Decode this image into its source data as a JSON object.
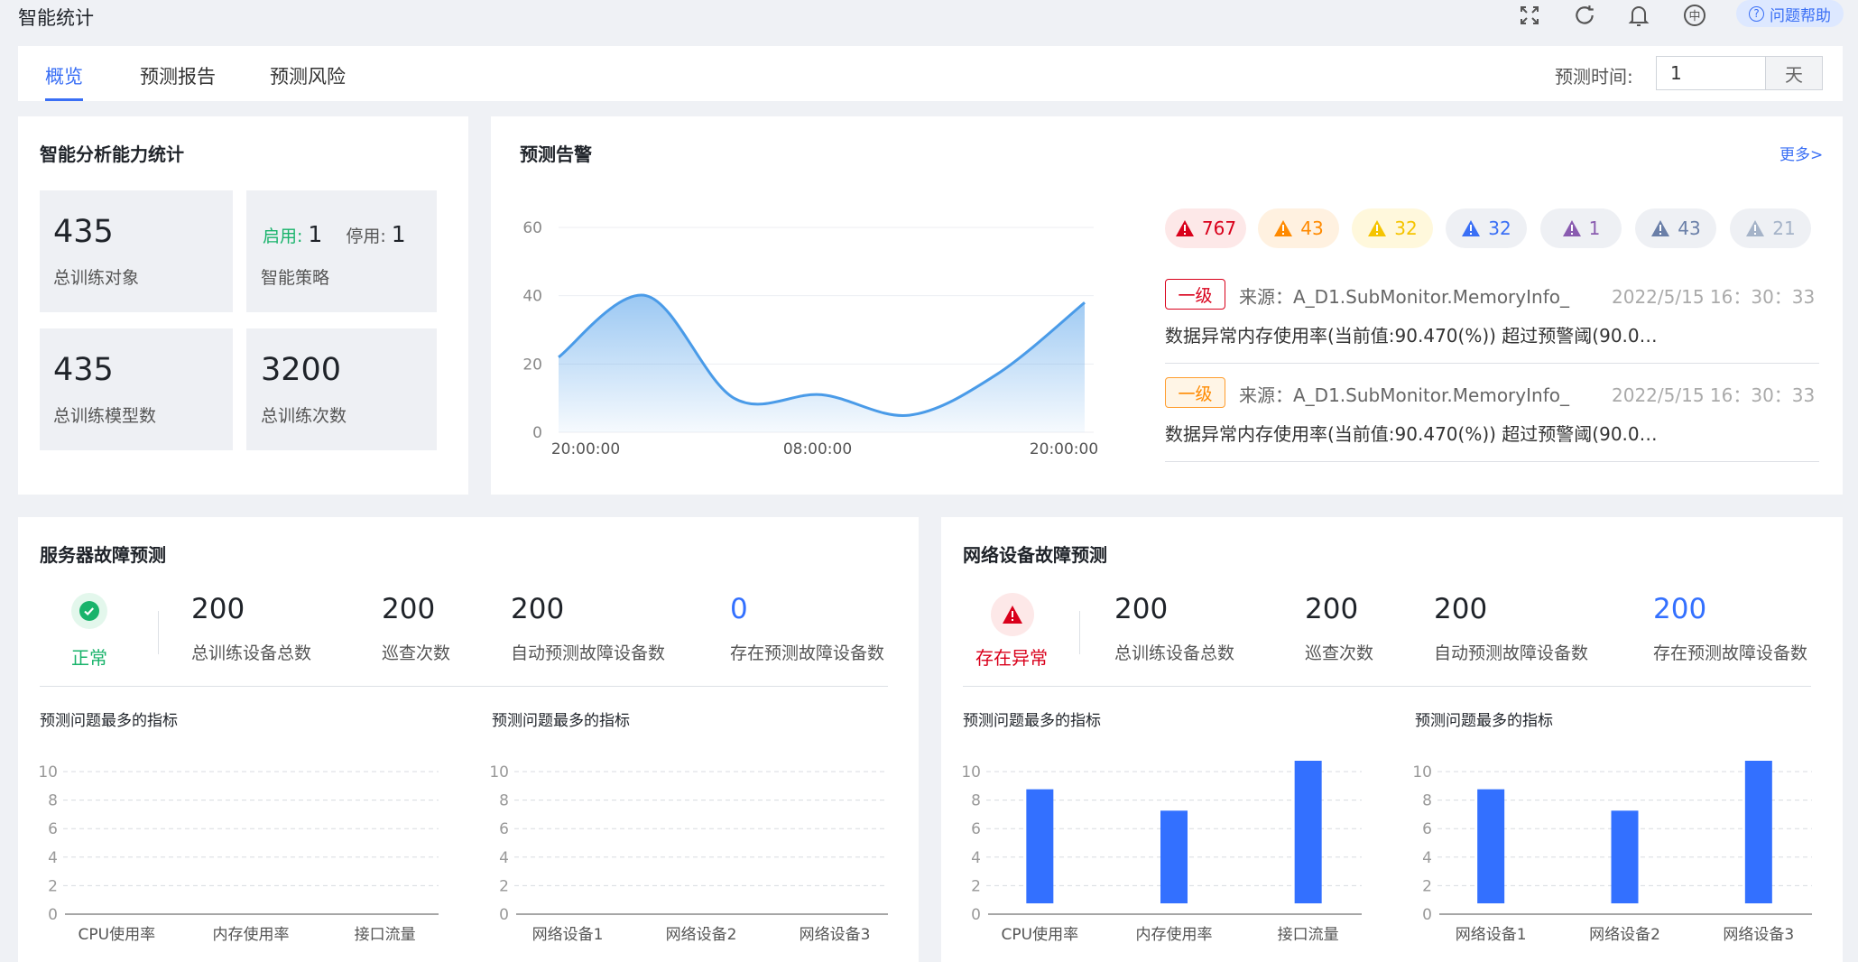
{
  "header": {
    "title": "智能统计",
    "icons": [
      "fullscreen-icon",
      "refresh-icon",
      "bell-icon",
      "language-icon"
    ],
    "language_label": "中",
    "help_label": "问题帮助"
  },
  "tabs": [
    {
      "label": "概览",
      "active": true
    },
    {
      "label": "预测报告",
      "active": false
    },
    {
      "label": "预测风险",
      "active": false
    }
  ],
  "predict_time": {
    "label": "预测时间:",
    "value": "1",
    "unit": "天"
  },
  "analysis": {
    "title": "智能分析能力统计",
    "training_objects": {
      "value": "435",
      "label": "总训练对象"
    },
    "strategy": {
      "enabled_label": "启用:",
      "enabled_value": "1",
      "disabled_label": "停用:",
      "disabled_value": "1",
      "label": "智能策略"
    },
    "models": {
      "value": "435",
      "label": "总训练模型数"
    },
    "trainings": {
      "value": "3200",
      "label": "总训练次数"
    }
  },
  "alerts": {
    "title": "预测告警",
    "more_label": "更多>",
    "badges": [
      {
        "value": "767",
        "color": "#d9001b",
        "bg": "#fde8e8"
      },
      {
        "value": "43",
        "color": "#ff8a00",
        "bg": "#fff1e0"
      },
      {
        "value": "32",
        "color": "#f5c400",
        "bg": "#fff8dc"
      },
      {
        "value": "32",
        "color": "#3a6ff5",
        "bg": "#eef0f4"
      },
      {
        "value": "1",
        "color": "#8a5cb0",
        "bg": "#eef0f4"
      },
      {
        "value": "43",
        "color": "#6a7fa8",
        "bg": "#eef0f4"
      },
      {
        "value": "21",
        "color": "#a5b3c8",
        "bg": "#eef0f4"
      }
    ],
    "items": [
      {
        "level": "一级",
        "source": "来源：A_D1.SubMonitor.MemoryInfo_",
        "time": "2022/5/15 16：30：33",
        "message": "数据异常内存使用率(当前值:90.470(%)) 超过预警阈(90.0…",
        "color": "#d9001b",
        "bg": "#fff"
      },
      {
        "level": "一级",
        "source": "来源：A_D1.SubMonitor.MemoryInfo_",
        "time": "2022/5/15 16：30：33",
        "message": "数据异常内存使用率(当前值:90.470(%)) 超过预警阈(90.0…",
        "color": "#ff8a00",
        "bg": "#fff5e6"
      }
    ]
  },
  "server": {
    "title": "服务器故障预测",
    "status": "正常",
    "status_color": "#19b36b",
    "stats": [
      {
        "value": "200",
        "label": "总训练设备总数"
      },
      {
        "value": "200",
        "label": "巡查次数"
      },
      {
        "value": "200",
        "label": "自动预测故障设备数"
      },
      {
        "value": "0",
        "label": "存在预测故障设备数",
        "highlight": true
      }
    ],
    "chart_titles": [
      "预测问题最多的指标",
      "预测问题最多的指标"
    ]
  },
  "network": {
    "title": "网络设备故障预测",
    "status": "存在异常",
    "status_color": "#d9001b",
    "stats": [
      {
        "value": "200",
        "label": "总训练设备总数"
      },
      {
        "value": "200",
        "label": "巡查次数"
      },
      {
        "value": "200",
        "label": "自动预测故障设备数"
      },
      {
        "value": "200",
        "label": "存在预测故障设备数",
        "highlight": true
      }
    ],
    "chart_titles": [
      "预测问题最多的指标",
      "预测问题最多的指标"
    ]
  },
  "chart_data": [
    {
      "type": "area",
      "title": "",
      "x": [
        "20:00:00",
        "",
        "",
        "08:00:00",
        "",
        "",
        "20:00:00"
      ],
      "xticks": [
        "20:00:00",
        "08:00:00",
        "20:00:00"
      ],
      "series": [
        {
          "values": [
            22,
            40,
            10,
            11,
            5,
            17,
            38
          ]
        }
      ],
      "ylim": [
        0,
        60
      ],
      "yticks": [
        0,
        20,
        40,
        60
      ],
      "color": "#4a9be8",
      "grid": true
    },
    {
      "type": "bar",
      "categories": [
        "CPU使用率",
        "内存使用率",
        "接口流量"
      ],
      "values": [
        0,
        0,
        0
      ],
      "ylim": [
        0,
        10
      ],
      "yticks": [
        0,
        2,
        4,
        6,
        8,
        10
      ],
      "color": "#3370ff",
      "grid": true
    },
    {
      "type": "bar",
      "categories": [
        "网络设备1",
        "网络设备2",
        "网络设备3"
      ],
      "values": [
        0,
        0,
        0
      ],
      "ylim": [
        0,
        10
      ],
      "yticks": [
        0,
        2,
        4,
        6,
        8,
        10
      ],
      "color": "#3370ff",
      "grid": true
    },
    {
      "type": "bar",
      "categories": [
        "CPU使用率",
        "内存使用率",
        "接口流量"
      ],
      "values": [
        8,
        6.5,
        10
      ],
      "ylim": [
        0,
        10
      ],
      "yticks": [
        0,
        2,
        4,
        6,
        8,
        10
      ],
      "color": "#3370ff",
      "grid": true
    },
    {
      "type": "bar",
      "categories": [
        "网络设备1",
        "网络设备2",
        "网络设备3"
      ],
      "values": [
        8,
        6.5,
        10
      ],
      "ylim": [
        0,
        10
      ],
      "yticks": [
        0,
        2,
        4,
        6,
        8,
        10
      ],
      "color": "#3370ff",
      "grid": true
    }
  ]
}
